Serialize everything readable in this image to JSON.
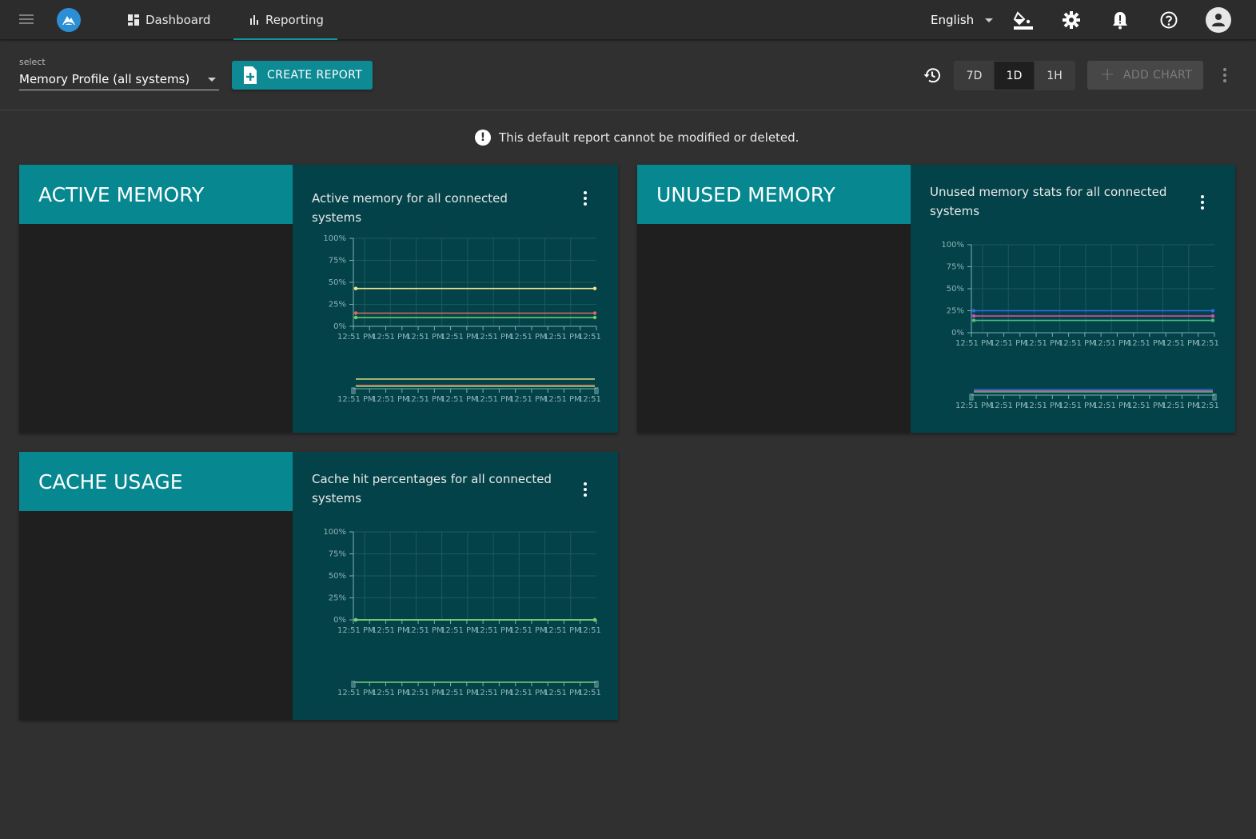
{
  "topbar": {
    "nav": [
      {
        "label": "Dashboard",
        "icon": "dashboard-icon"
      },
      {
        "label": "Reporting",
        "icon": "bar-chart-icon"
      }
    ],
    "language": "English",
    "icons": [
      "paint-bucket-icon",
      "gear-icon",
      "bell-alert-icon",
      "help-icon",
      "account-icon"
    ]
  },
  "toolbar": {
    "select_label": "select",
    "select_value": "Memory Profile (all systems)",
    "create_label": "CREATE REPORT",
    "ranges": [
      "7D",
      "1D",
      "1H"
    ],
    "active_range": "1D",
    "add_chart_label": "ADD CHART"
  },
  "notice": "This default report cannot be modified or deleted.",
  "cards": [
    {
      "title": "ACTIVE MEMORY",
      "description": "Active memory for all connected systems"
    },
    {
      "title": "UNUSED MEMORY",
      "description": "Unused memory stats for all connected systems"
    },
    {
      "title": "CACHE USAGE",
      "description": "Cache hit percentages for all connected systems"
    }
  ],
  "colors": {
    "accent": "#078891",
    "card_panel": "#034249",
    "background": "#303030"
  },
  "chart_data": [
    {
      "type": "line",
      "y_ticks": [
        "100%",
        "75%",
        "50%",
        "25%",
        "0%"
      ],
      "x_ticks": [
        "12:51 PM",
        "12:51 PM",
        "12:51 PM",
        "12:51 PM",
        "12:51 PM",
        "12:51 PM",
        "12:51 PM",
        "12:51"
      ],
      "ylim": [
        0,
        100
      ],
      "series": [
        {
          "color": "#f2e88a",
          "values": [
            43,
            43
          ]
        },
        {
          "color": "#e2685e",
          "values": [
            15,
            15
          ]
        },
        {
          "color": "#6fd36f",
          "values": [
            10,
            10
          ]
        }
      ]
    },
    {
      "type": "line",
      "y_ticks": [
        "100%",
        "75%",
        "50%",
        "25%",
        "0%"
      ],
      "x_ticks": [
        "12:51 PM",
        "12:51 PM",
        "12:51 PM",
        "12:51 PM",
        "12:51 PM",
        "12:51 PM",
        "12:51 PM",
        "12:51"
      ],
      "ylim": [
        0,
        100
      ],
      "series": [
        {
          "color": "#2f6fe6",
          "values": [
            25,
            25
          ]
        },
        {
          "color": "#d64fa0",
          "values": [
            19,
            19
          ]
        },
        {
          "color": "#4fbf7f",
          "values": [
            14,
            14
          ]
        }
      ]
    },
    {
      "type": "line",
      "y_ticks": [
        "100%",
        "75%",
        "50%",
        "25%",
        "0%"
      ],
      "x_ticks": [
        "12:51 PM",
        "12:51 PM",
        "12:51 PM",
        "12:51 PM",
        "12:51 PM",
        "12:51 PM",
        "12:51 PM",
        "12:51"
      ],
      "ylim": [
        0,
        100
      ],
      "series": [
        {
          "color": "#f2e88a",
          "values": [
            0,
            0
          ]
        },
        {
          "color": "#6fd36f",
          "values": [
            0,
            0
          ]
        }
      ]
    }
  ]
}
